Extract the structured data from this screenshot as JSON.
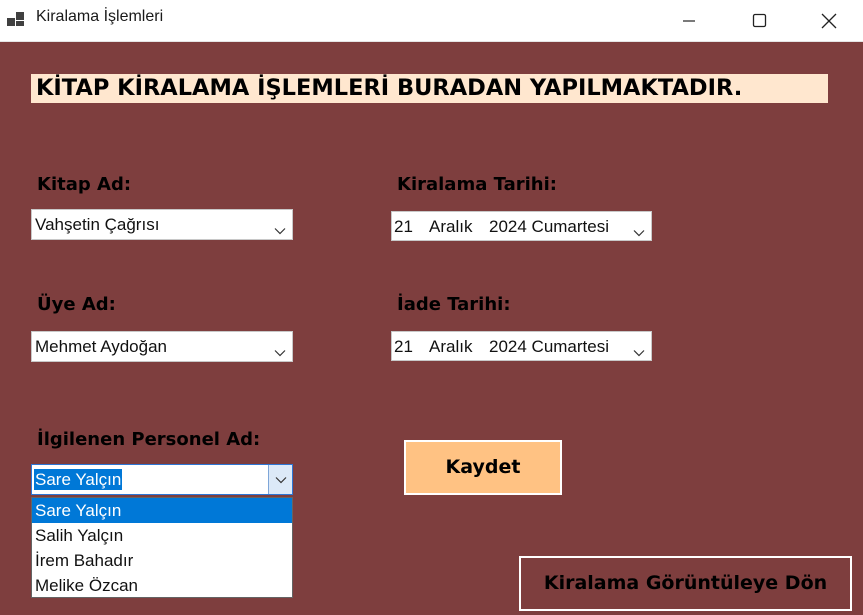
{
  "window": {
    "title": "Kiralama İşlemleri"
  },
  "banner": {
    "text": "KİTAP KİRALAMA İŞLEMLERİ BURADAN YAPILMAKTADIR."
  },
  "form": {
    "book": {
      "label": "Kitap Ad:",
      "value": "Vahşetin Çağrısı"
    },
    "member": {
      "label": "Üye Ad:",
      "value": "Mehmet Aydoğan"
    },
    "staff": {
      "label": "İlgilenen Personel Ad:",
      "value": "Sare Yalçın",
      "options": [
        "Sare Yalçın",
        "Salih Yalçın",
        "İrem Bahadır",
        "Melike Özcan"
      ]
    },
    "rental_date": {
      "label": "Kiralama Tarihi:",
      "day": "21",
      "month": "Aralık",
      "rest": "2024 Cumartesi"
    },
    "return_date": {
      "label": "İade Tarihi:",
      "day": "21",
      "month": "Aralık",
      "rest": "2024 Cumartesi"
    }
  },
  "buttons": {
    "save": "Kaydet",
    "back": "Kiralama Görüntüleye Dön"
  },
  "colors": {
    "background": "#7e3e3e",
    "banner": "#ffe7cf",
    "save_button": "#ffc283",
    "selection": "#0078d7"
  },
  "icons": {
    "app": "app-icon",
    "minimize": "minimize-icon",
    "maximize": "maximize-icon",
    "close": "close-icon",
    "dropdown": "chevron-down-icon"
  }
}
